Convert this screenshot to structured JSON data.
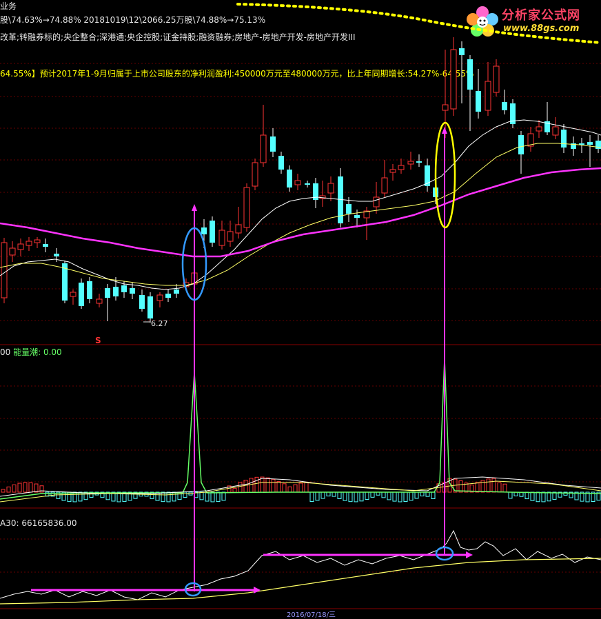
{
  "header": {
    "top_text": "业务",
    "stats_line": "股\\74.63%→74.88% 20181019\\12\\2066.25万股\\74.88%→75.13%",
    "concepts_line": "改革;转融券标的;央企整合;深港通;央企控股;证金持股;融资融券;房地产-房地产开发-房地产开发III",
    "forecast_line": "64.55%】预计2017年1-9月归属于上市公司股东的净利润盈利:450000万元至480000万元，比上年同期增长:54.27%-64.55%"
  },
  "logo": {
    "main": "分析家公式网",
    "sub": "www.88gs.com"
  },
  "price_panel": {
    "low_label": "6.27",
    "s_mark": "S"
  },
  "volume_panel": {
    "value_prefix": "00",
    "indicator_label": "能量潮: 0.00"
  },
  "ma_panel": {
    "label": "A30: 66165836.00"
  },
  "bottom": {
    "date_tag": "2016/07/18/三"
  },
  "colors": {
    "up": "#ff3333",
    "down": "#54ffff",
    "ma_white": "#ffffff",
    "ma_yellow": "#ffff66",
    "ma_magenta": "#ff33ff",
    "grid": "#660000",
    "annotation": "#ff33ff"
  }
}
